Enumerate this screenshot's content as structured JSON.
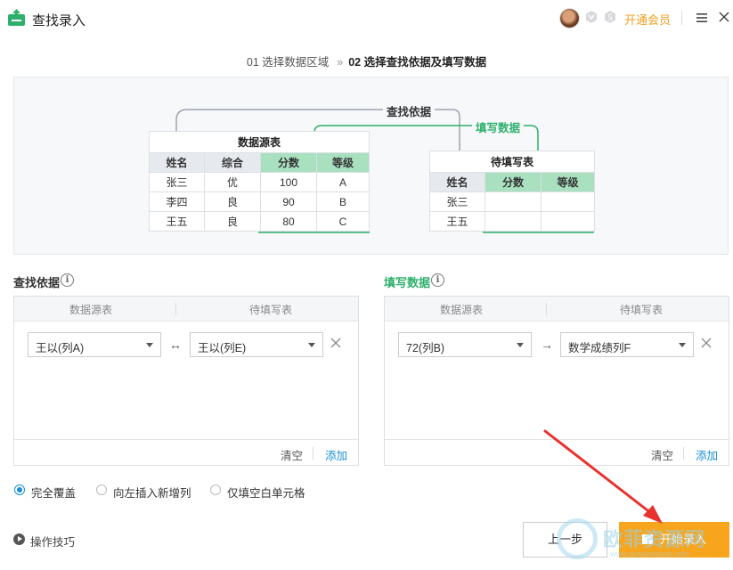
{
  "window": {
    "title": "查找录入",
    "vip_label": "开通会员"
  },
  "steps": {
    "step1": "01 选择数据区域",
    "separator": "»",
    "step2": "02 选择查找依据及填写数据"
  },
  "illustration": {
    "lookup_label": "查找依据",
    "fill_label": "填写数据",
    "source_table": {
      "caption": "数据源表",
      "headers": [
        "姓名",
        "综合",
        "分数",
        "等级"
      ],
      "rows": [
        [
          "张三",
          "优",
          "100",
          "A"
        ],
        [
          "李四",
          "良",
          "90",
          "B"
        ],
        [
          "王五",
          "良",
          "80",
          "C"
        ]
      ]
    },
    "target_table": {
      "caption": "待填写表",
      "headers": [
        "姓名",
        "分数",
        "等级"
      ],
      "rows": [
        [
          "张三",
          "",
          ""
        ],
        [
          "王五",
          "",
          ""
        ]
      ]
    }
  },
  "lookup": {
    "title": "查找依据",
    "col_source": "数据源表",
    "col_target": "待填写表",
    "source_value": "王以(列A)",
    "link_symbol": "↔",
    "target_value": "王以(列E)",
    "clear": "清空",
    "add": "添加"
  },
  "fill": {
    "title": "填写数据",
    "col_source": "数据源表",
    "col_target": "待填写表",
    "source_value": "72(列B)",
    "link_symbol": "→",
    "target_value": "数学成绩列F",
    "clear": "清空",
    "add": "添加"
  },
  "options": {
    "selected": "完全覆盖",
    "items": [
      "完全覆盖",
      "向左插入新增列",
      "仅填空白单元格"
    ]
  },
  "tips": "操作技巧",
  "buttons": {
    "prev": "上一步",
    "start": "开始录入"
  },
  "watermark": {
    "line1": "欧菲资源网",
    "line2": "www.ouyaoxiazai.com"
  },
  "colors": {
    "accent_green": "#2db06b",
    "link_blue": "#1a8fd6",
    "primary_orange": "#f7a51c",
    "annotation_red": "#e8322d"
  }
}
